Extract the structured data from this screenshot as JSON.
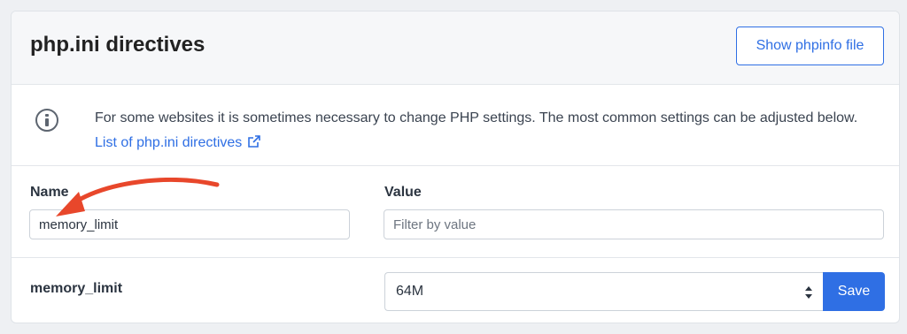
{
  "header": {
    "title": "php.ini directives",
    "phpinfo_button": "Show phpinfo file"
  },
  "info": {
    "icon": "info-circle-icon",
    "text": "For some websites it is sometimes necessary to change PHP settings. The most common settings can be adjusted below.",
    "link_label": "List of php.ini directives",
    "link_icon": "external-link-icon"
  },
  "filters": {
    "name_label": "Name",
    "name_value": "memory_limit",
    "value_label": "Value",
    "value_placeholder": "Filter by value"
  },
  "directive": {
    "name": "memory_limit",
    "selected_value": "64M",
    "save_label": "Save"
  },
  "colors": {
    "accent": "#2f6fe4",
    "annotation_arrow": "#e8472b"
  }
}
